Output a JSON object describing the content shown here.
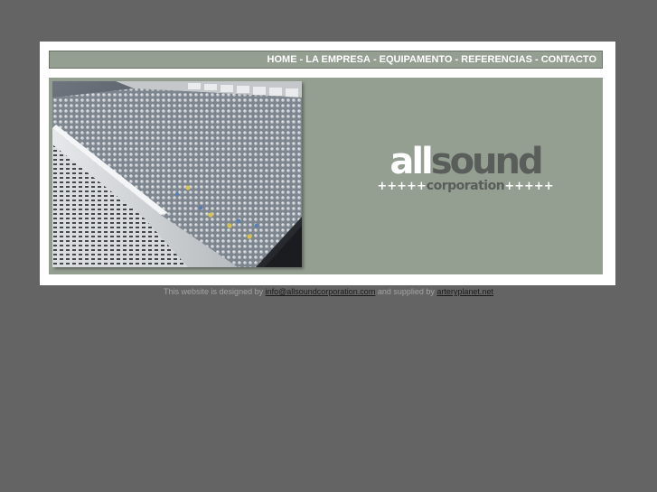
{
  "nav": {
    "items": [
      "HOME",
      "LA EMPRESA",
      "EQUIPAMENTO",
      "REFERENCIAS",
      "CONTACTO"
    ],
    "separator": "-"
  },
  "logo": {
    "word_light": "all",
    "word_dark": "sound",
    "plus_left": "+++++",
    "sub": "corporation",
    "plus_right": "+++++"
  },
  "footer": {
    "prefix": "This website is designed by",
    "email": "info@allsoundcorporation.com",
    "middle": "and supplied by",
    "link": "arteryplanet.net"
  },
  "colors": {
    "background": "#646464",
    "panel": "#949e91",
    "logo_dark": "#5a5e5b"
  },
  "image": {
    "semantic": "audio mixing console photo"
  }
}
